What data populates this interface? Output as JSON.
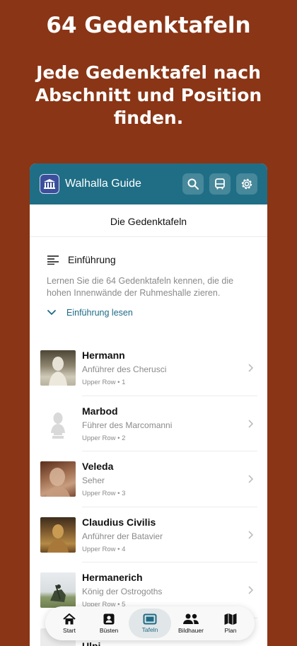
{
  "promo": {
    "title": "64 Gedenktafeln",
    "subtitle": "Jede Gedenktafel nach Abschnitt und Position finden."
  },
  "appbar": {
    "title": "Walhalla Guide",
    "icons": [
      "search-icon",
      "bus-icon",
      "settings-icon"
    ]
  },
  "page": {
    "title": "Die Gedenktafeln"
  },
  "intro": {
    "heading": "Einführung",
    "text": "Lernen Sie die 64 Gedenktafeln kennen, die die hohen Innenwände der Ruhmeshalle zieren.",
    "link": "Einführung lesen"
  },
  "tablets": [
    {
      "name": "Hermann",
      "desc": "Anführer des Cherusci",
      "pos": "Upper Row • 1"
    },
    {
      "name": "Marbod",
      "desc": "Führer des Marcomanni",
      "pos": "Upper Row • 2"
    },
    {
      "name": "Veleda",
      "desc": "Seher",
      "pos": "Upper Row • 3"
    },
    {
      "name": "Claudius Civilis",
      "desc": "Anführer der Batavier",
      "pos": "Upper Row • 4"
    },
    {
      "name": "Hermanerich",
      "desc": "König der Ostrogoths",
      "pos": "Upper Row • 5"
    },
    {
      "name": "Ulpi",
      "desc": "",
      "pos": ""
    }
  ],
  "tabs": [
    {
      "label": "Start",
      "icon": "home-icon"
    },
    {
      "label": "Büsten",
      "icon": "bust-icon"
    },
    {
      "label": "Tafeln",
      "icon": "tablet-icon",
      "active": true
    },
    {
      "label": "Bildhauer",
      "icon": "people-icon"
    },
    {
      "label": "Plan",
      "icon": "map-icon"
    }
  ],
  "colors": {
    "background": "#8a3516",
    "appbar": "#1f6e86",
    "accent": "#1d6b86"
  }
}
